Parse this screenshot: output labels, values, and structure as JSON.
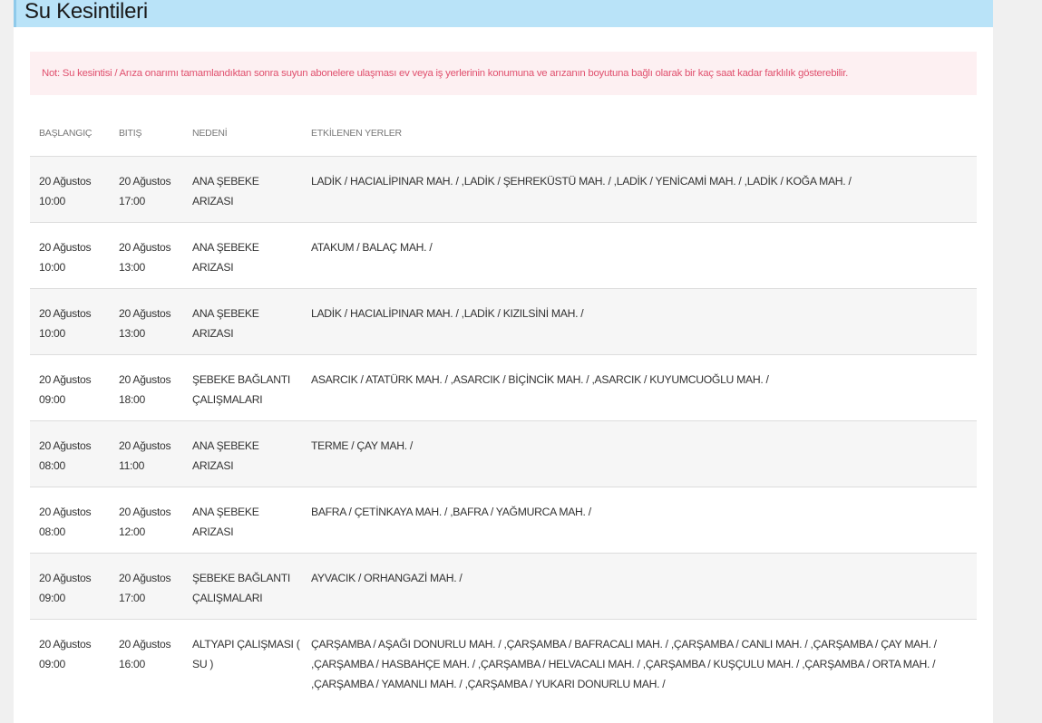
{
  "page": {
    "title": "Su Kesintileri",
    "note": "Not: Su kesintisi / Arıza onarımı tamamlandıktan sonra suyun abonelere ulaşması ev veya iş yerlerinin konumuna ve arızanın boyutuna bağlı olarak bir kaç saat kadar farklılık gösterebilir."
  },
  "table": {
    "headers": {
      "start": "BAŞLANGIÇ",
      "end": "BITIŞ",
      "reason": "NEDENİ",
      "places": "ETKİLENEN YERLER"
    },
    "rows": [
      {
        "start_date": "20 Ağustos",
        "start_time": "10:00",
        "end_date": "20 Ağustos",
        "end_time": "17:00",
        "reason": "ANA ŞEBEKE ARIZASI",
        "places": "LADİK / HACIALİPINAR MAH. / ,LADİK / ŞEHREKÜSTÜ MAH. / ,LADİK / YENİCAMİ MAH. / ,LADİK / KOĞA MAH. /"
      },
      {
        "start_date": "20 Ağustos",
        "start_time": "10:00",
        "end_date": "20 Ağustos",
        "end_time": "13:00",
        "reason": "ANA ŞEBEKE ARIZASI",
        "places": "ATAKUM / BALAÇ MAH. /"
      },
      {
        "start_date": "20 Ağustos",
        "start_time": "10:00",
        "end_date": "20 Ağustos",
        "end_time": "13:00",
        "reason": "ANA ŞEBEKE ARIZASI",
        "places": "LADİK / HACIALİPINAR MAH. / ,LADİK / KIZILSİNİ MAH. /"
      },
      {
        "start_date": "20 Ağustos",
        "start_time": "09:00",
        "end_date": "20 Ağustos",
        "end_time": "18:00",
        "reason": "ŞEBEKE BAĞLANTI ÇALIŞMALARI",
        "places": "ASARCIK / ATATÜRK MAH. / ,ASARCIK / BİÇİNCİK MAH. / ,ASARCIK / KUYUMCUOĞLU MAH. /"
      },
      {
        "start_date": "20 Ağustos",
        "start_time": "08:00",
        "end_date": "20 Ağustos",
        "end_time": "11:00",
        "reason": "ANA ŞEBEKE ARIZASI",
        "places": "TERME / ÇAY MAH. /"
      },
      {
        "start_date": "20 Ağustos",
        "start_time": "08:00",
        "end_date": "20 Ağustos",
        "end_time": "12:00",
        "reason": "ANA ŞEBEKE ARIZASI",
        "places": "BAFRA / ÇETİNKAYA MAH. / ,BAFRA / YAĞMURCA MAH. /"
      },
      {
        "start_date": "20 Ağustos",
        "start_time": "09:00",
        "end_date": "20 Ağustos",
        "end_time": "17:00",
        "reason": "ŞEBEKE BAĞLANTI ÇALIŞMALARI",
        "places": "AYVACIK / ORHANGAZİ MAH. /"
      },
      {
        "start_date": "20 Ağustos",
        "start_time": "09:00",
        "end_date": "20 Ağustos",
        "end_time": "16:00",
        "reason": "ALTYAPI ÇALIŞMASI ( SU )",
        "places": "ÇARŞAMBA / AŞAĞI DONURLU MAH. / ,ÇARŞAMBA / BAFRACALI MAH. / ,ÇARŞAMBA / CANLI MAH. / ,ÇARŞAMBA / ÇAY MAH. / ,ÇARŞAMBA / HASBAHÇE MAH. / ,ÇARŞAMBA / HELVACALI MAH. / ,ÇARŞAMBA / KUŞÇULU MAH. / ,ÇARŞAMBA / ORTA MAH. / ,ÇARŞAMBA / YAMANLI MAH. / ,ÇARŞAMBA / YUKARI DONURLU MAH. /"
      }
    ]
  }
}
